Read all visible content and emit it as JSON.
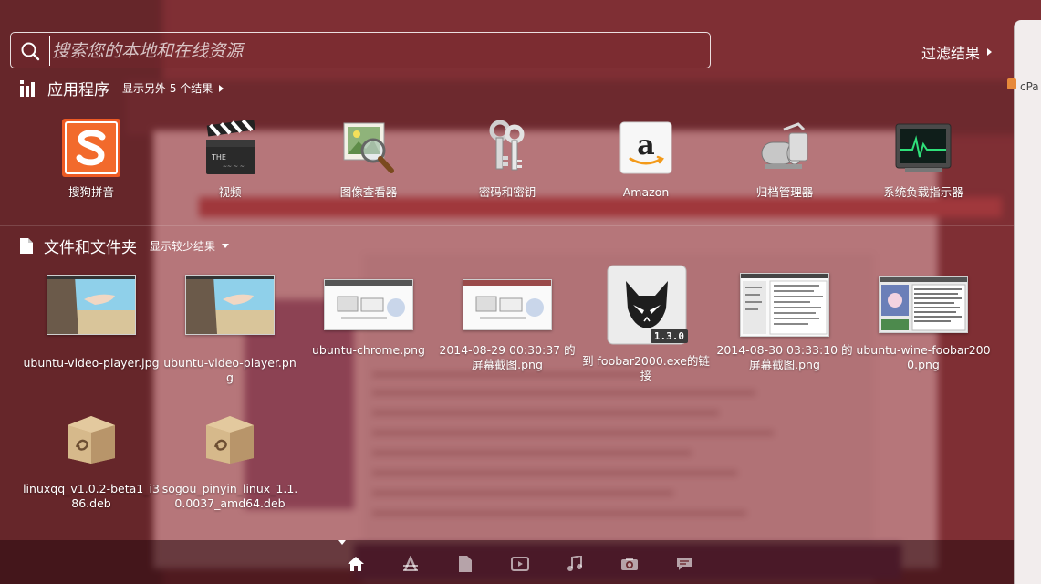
{
  "search": {
    "placeholder": "搜索您的本地和在线资源"
  },
  "filter": {
    "label": "过滤结果"
  },
  "edge_hint": {
    "text": "cPa"
  },
  "apps_section": {
    "title": "应用程序",
    "more_label": "显示另外 5 个结果",
    "items": [
      {
        "label": "搜狗拼音",
        "icon": "sogou-pinyin-icon"
      },
      {
        "label": "视频",
        "icon": "video-clapper-icon"
      },
      {
        "label": "图像查看器",
        "icon": "image-viewer-icon"
      },
      {
        "label": "密码和密钥",
        "icon": "keys-icon"
      },
      {
        "label": "Amazon",
        "icon": "amazon-icon"
      },
      {
        "label": "归档管理器",
        "icon": "archive-manager-icon"
      },
      {
        "label": "系统负载指示器",
        "icon": "system-load-icon"
      }
    ]
  },
  "files_section": {
    "title": "文件和文件夹",
    "more_label": "显示较少结果",
    "items": [
      {
        "label": "ubuntu-video-player.jpg",
        "icon": "video-player-thumbnail"
      },
      {
        "label": "ubuntu-video-player.png",
        "icon": "video-player-thumbnail"
      },
      {
        "label": "ubuntu-chrome.png",
        "icon": "chrome-screenshot-thumbnail"
      },
      {
        "label": "2014-08-29 00:30:37 的屏幕截图.png",
        "icon": "screenshot-thumbnail"
      },
      {
        "label": "到 foobar2000.exe的链接",
        "icon": "foobar2000-icon",
        "badge": "1.3.0"
      },
      {
        "label": "2014-08-30 03:33:10 的屏幕截图.png",
        "icon": "screenshot-thumbnail"
      },
      {
        "label": "ubuntu-wine-foobar2000.png",
        "icon": "wine-foobar-thumbnail"
      },
      {
        "label": "linuxqq_v1.0.2-beta1_i386.deb",
        "icon": "deb-package-icon"
      },
      {
        "label": "sogou_pinyin_linux_1.1.0.0037_amd64.deb",
        "icon": "deb-package-icon"
      }
    ]
  },
  "lenses": [
    {
      "name": "home",
      "icon": "home-icon",
      "active": true
    },
    {
      "name": "applications",
      "icon": "applications-icon"
    },
    {
      "name": "files",
      "icon": "files-icon"
    },
    {
      "name": "video",
      "icon": "video-icon"
    },
    {
      "name": "music",
      "icon": "music-icon"
    },
    {
      "name": "photos",
      "icon": "camera-icon"
    },
    {
      "name": "social",
      "icon": "social-icon"
    }
  ],
  "colors": {
    "tint": "#963740",
    "sogou": "#ee5a24",
    "monitor_green": "#2fe07a"
  }
}
